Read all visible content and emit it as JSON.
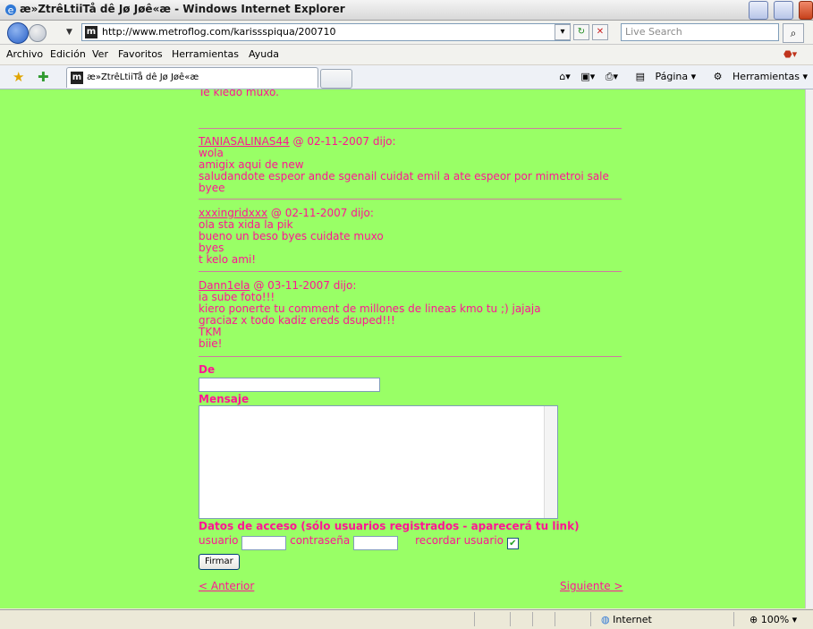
{
  "window": {
    "title": "æ»ZtrêLtiiTå dê Jø Jøê«æ - Windows Internet Explorer"
  },
  "address": {
    "url": "http://www.metroflog.com/karissspiqua/200710",
    "search_placeholder": "Live Search"
  },
  "menu": {
    "items": [
      "Archivo",
      "Edición",
      "Ver",
      "Favoritos",
      "Herramientas",
      "Ayuda"
    ]
  },
  "tab": {
    "title": "æ»ZtrêLtiiTå dê Jø Jøê«æ"
  },
  "toolbar": {
    "page": "Página",
    "tools": "Herramientas"
  },
  "content": {
    "top_partial": "Te kiedo muxo.",
    "comments": [
      {
        "author": "TANIASALINAS44",
        "meta": " @ 02-11-2007 dijo:",
        "lines": [
          "wola",
          "amigix aqui de new",
          "saludandote espeor ande sgenail cuidat emil a ate espeor por mimetroi sale",
          "byee"
        ]
      },
      {
        "author": "xxxingridxxx",
        "meta": " @ 02-11-2007 dijo:",
        "lines": [
          "ola sta xida la pik",
          "bueno un beso byes cuidate muxo",
          "byes",
          "t kelo ami!"
        ]
      },
      {
        "author": "Dann1ela",
        "meta": " @ 03-11-2007 dijo:",
        "lines": [
          "ia sube foto!!!",
          "kiero ponerte tu comment de millones de lineas kmo tu ;) jajaja",
          "graciaz x todo kadiz ereds dsuped!!!",
          "TKM",
          "biie!"
        ]
      }
    ],
    "form": {
      "de_label": "De",
      "mensaje_label": "Mensaje",
      "access_label": "Datos de acceso (sólo usuarios registrados - aparecerá tu link)",
      "usuario_label": "usuario",
      "password_label": "contraseña",
      "remember_label": "recordar usuario",
      "submit_label": "Firmar"
    },
    "nav": {
      "prev": "< Anterior",
      "next": "Siguiente >"
    }
  },
  "status": {
    "zone": "Internet",
    "zoom": "100%"
  },
  "colors": {
    "page_bg": "#99ff66",
    "text": "#ff1493"
  },
  "icons": [
    "ie-icon",
    "back-icon",
    "forward-icon",
    "refresh-icon",
    "stop-icon",
    "search-icon",
    "feed-icon",
    "home-icon",
    "print-icon",
    "page-icon",
    "gear-icon",
    "star-icon",
    "add-favorite-icon",
    "globe-icon",
    "zoom-icon"
  ]
}
